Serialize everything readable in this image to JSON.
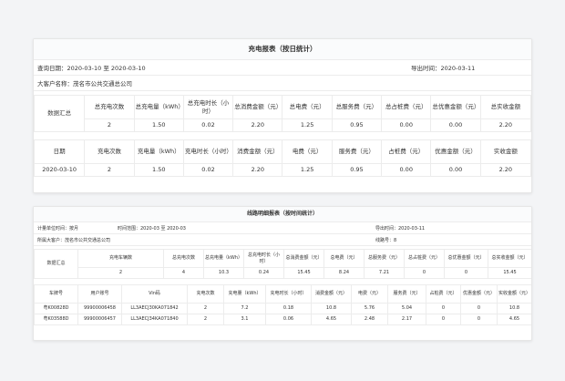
{
  "report1": {
    "title": "充电报表（按日统计）",
    "query_date": "查询日期：2020-03-10 至 2020-03-10",
    "export_time": "导出时间：2020-03-11",
    "customer": "大客户名称：茂名市公共交通总公司",
    "summary_label": "数据汇总",
    "summary_headers": [
      "总充电次数",
      "总充电量（kWh）",
      "总充电时长（小时）",
      "总消费金额（元）",
      "总电费（元）",
      "总服务费（元）",
      "总占桩费（元）",
      "总优惠金额（元）",
      "总实收金额"
    ],
    "summary_values": [
      "2",
      "1.50",
      "0.02",
      "2.20",
      "1.25",
      "0.95",
      "0.00",
      "0.00",
      "2.20"
    ],
    "detail_headers": [
      "日期",
      "充电次数",
      "充电量（kWh）",
      "充电时长（小时）",
      "消费金额（元）",
      "电费（元）",
      "服务费（元）",
      "占桩费（元）",
      "优惠金额（元）",
      "实收金额"
    ],
    "detail_rows": [
      [
        "2020-03-10",
        "2",
        "1.50",
        "0.02",
        "2.20",
        "1.25",
        "0.95",
        "0.00",
        "0.00",
        "2.20"
      ]
    ]
  },
  "report2": {
    "title": "线路明细报表（按时间统计）",
    "unit": "计量单位时间：按月",
    "range": "时间范围：2020-03 至 2020-03",
    "export_time": "导出时间：2020-03-11",
    "customer": "所属大客户：茂名市公共交通总公司",
    "line_no": "线路号：8",
    "summary_label": "数据汇总",
    "summary_headers": [
      "充电车辆数",
      "总充电次数",
      "总充电量（kWh）",
      "总充电时长（小时）",
      "总消费金额（元）",
      "总电费（元）",
      "总服务费（元）",
      "总占桩费（元）",
      "总优惠金额（元）",
      "总实收金额（元）"
    ],
    "summary_values": [
      "2",
      "4",
      "10.3",
      "0.24",
      "15.45",
      "8.24",
      "7.21",
      "0",
      "0",
      "15.45"
    ],
    "detail_headers": [
      "车牌号",
      "用户账号",
      "Vin码",
      "充电次数",
      "充电量（kWh）",
      "充电时长（小时）",
      "消费金额（元）",
      "电费（元）",
      "服务费（元）",
      "占桩费（元）",
      "优惠金额（元）",
      "实收金额（元）"
    ],
    "detail_rows": [
      [
        "粤K00828D",
        "99900006458",
        "LL3AECJ30KA071842",
        "2",
        "7.2",
        "0.18",
        "10.8",
        "5.76",
        "5.04",
        "0",
        "0",
        "10.8"
      ],
      [
        "粤K03588D",
        "99900006457",
        "LL3AECJ34KA071840",
        "2",
        "3.1",
        "0.06",
        "4.65",
        "2.48",
        "2.17",
        "0",
        "0",
        "4.65"
      ]
    ]
  }
}
